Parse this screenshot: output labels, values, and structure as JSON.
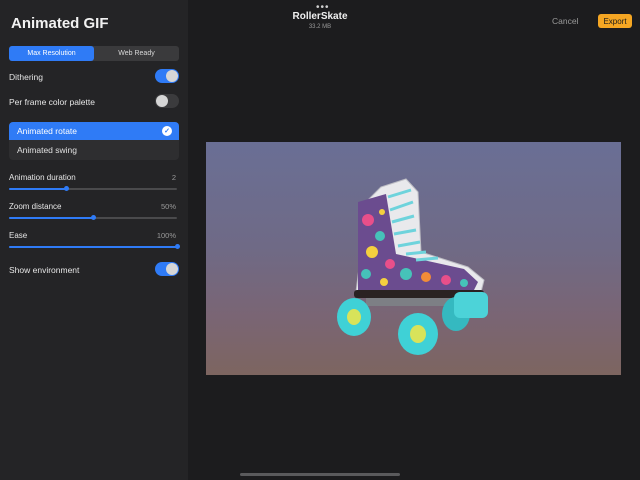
{
  "header": {
    "menu_dots": "•••",
    "doc_title": "RollerSkate",
    "doc_size": "33.2 MB",
    "cancel_label": "Cancel",
    "export_label": "Export"
  },
  "panel": {
    "title": "Animated GIF",
    "resolution_tabs": [
      {
        "label": "Max Resolution",
        "active": true
      },
      {
        "label": "Web Ready",
        "active": false
      }
    ],
    "dithering": {
      "label": "Dithering",
      "on": true
    },
    "per_frame_palette": {
      "label": "Per frame color palette",
      "on": false
    },
    "animation_types": [
      {
        "label": "Animated rotate",
        "selected": true
      },
      {
        "label": "Animated swing",
        "selected": false
      }
    ],
    "sliders": [
      {
        "label": "Animation duration",
        "value_text": "2",
        "fraction": 0.34
      },
      {
        "label": "Zoom distance",
        "value_text": "50%",
        "fraction": 0.5
      },
      {
        "label": "Ease",
        "value_text": "100%",
        "fraction": 1.0
      }
    ],
    "show_environment": {
      "label": "Show environment",
      "on": true
    }
  },
  "colors": {
    "accent": "#2f7bf6",
    "export_button": "#f5a623",
    "sidebar_bg": "#242426"
  }
}
